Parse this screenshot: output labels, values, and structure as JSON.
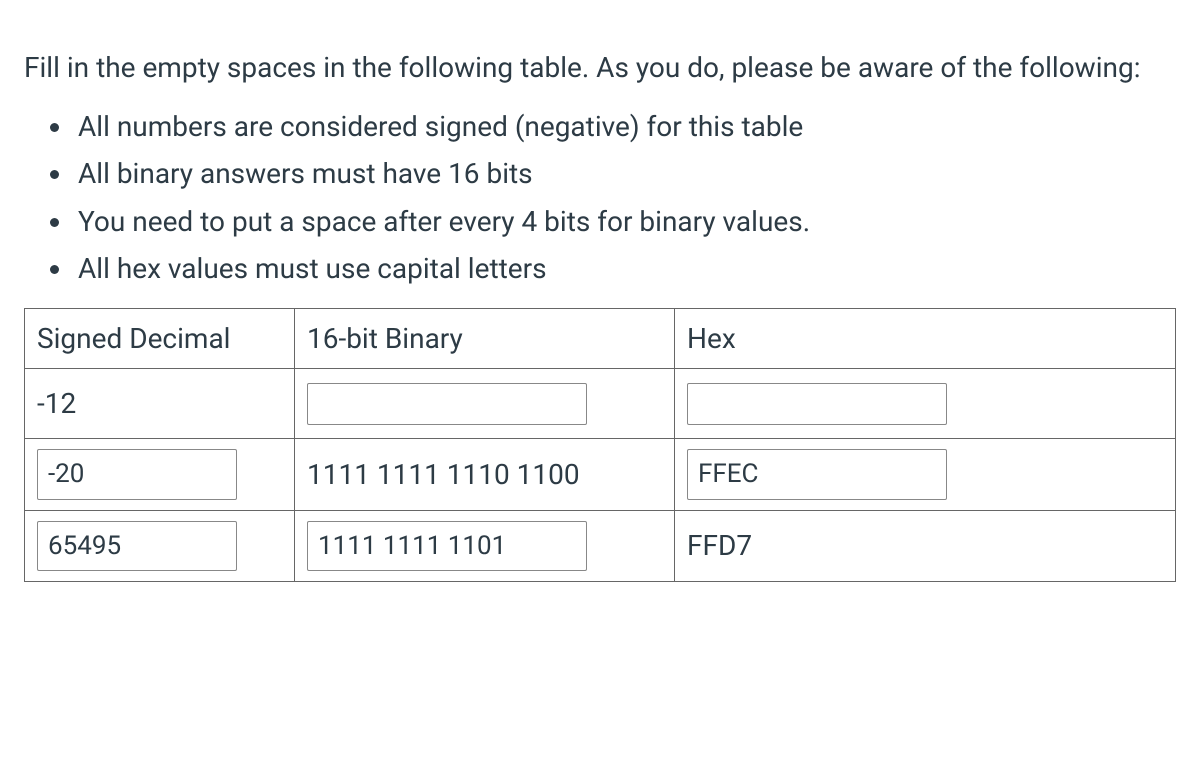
{
  "intro": "Fill in the empty spaces in the following table. As you do, please be aware of the following:",
  "bullets": [
    "All numbers are considered signed (negative) for this table",
    "All binary answers must have 16 bits",
    "You need to put a space after every 4 bits for binary values.",
    "All hex values must use capital letters"
  ],
  "headers": {
    "decimal": "Signed Decimal",
    "binary": "16-bit Binary",
    "hex": "Hex"
  },
  "rows": [
    {
      "decimal": {
        "type": "static",
        "value": "-12"
      },
      "binary": {
        "type": "input",
        "value": ""
      },
      "hex": {
        "type": "input",
        "value": ""
      }
    },
    {
      "decimal": {
        "type": "input",
        "value": "-20"
      },
      "binary": {
        "type": "static",
        "value": "1111 1111 1110 1100"
      },
      "hex": {
        "type": "input",
        "value": "FFEC"
      }
    },
    {
      "decimal": {
        "type": "input",
        "value": "65495"
      },
      "binary": {
        "type": "input",
        "value": "1111 1111 1101"
      },
      "hex": {
        "type": "static",
        "value": "FFD7"
      }
    }
  ]
}
